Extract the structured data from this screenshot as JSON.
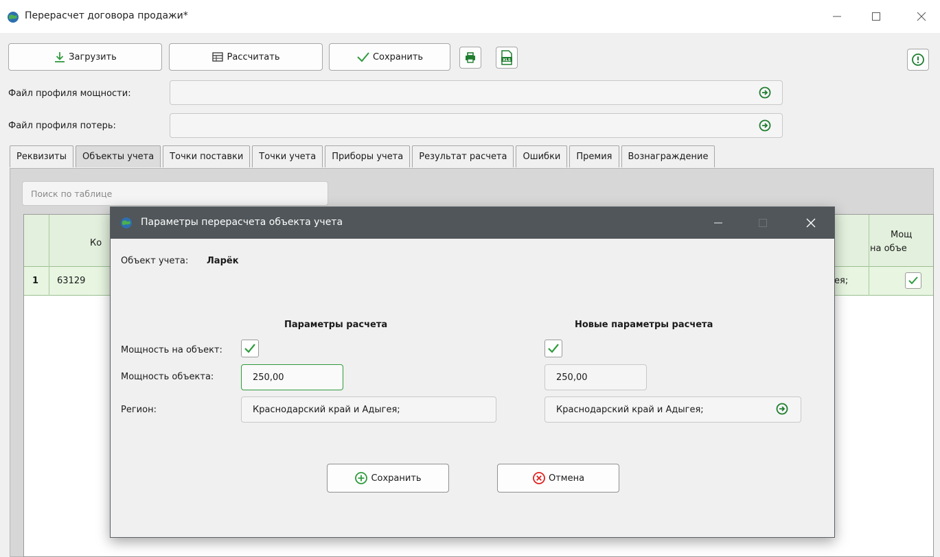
{
  "window": {
    "title": "Перерасчет договора продажи*"
  },
  "toolbar": {
    "load_label": "Загрузить",
    "calc_label": "Рассчитать",
    "save_label": "Сохранить"
  },
  "files": {
    "power_profile_label": "Файл профиля мощности:",
    "power_profile_value": "",
    "loss_profile_label": "Файл профиля потерь:",
    "loss_profile_value": ""
  },
  "tabs": [
    "Реквизиты",
    "Объекты учета",
    "Точки поставки",
    "Точки учета",
    "Приборы учета",
    "Результат расчета",
    "Ошибки",
    "Премия",
    "Вознаграждение"
  ],
  "active_tab": "Объекты учета",
  "search": {
    "placeholder": "Поиск по таблице"
  },
  "grid": {
    "header_code_partial": "Ко",
    "header_right_line1": "Мощ",
    "header_right_line2": "на объе",
    "row": {
      "number": "1",
      "code": "63129",
      "region_partial": "ея;"
    }
  },
  "dialog": {
    "title": "Параметры перерасчета объекта учета",
    "object_label": "Объект учета:",
    "object_value": "Ларёк",
    "col_current": "Параметры расчета",
    "col_new": "Новые параметры расчета",
    "power_on_label": "Мощность на объект:",
    "power_label": "Мощность объекта:",
    "region_label": "Регион:",
    "power_current": "250,00",
    "power_new": "250,00",
    "region_current": "Краснодарский край и Адыгея;",
    "region_new": "Краснодарский край и Адыгея;",
    "power_on_current": true,
    "power_on_new": true,
    "save_label": "Сохранить",
    "cancel_label": "Отмена"
  },
  "colors": {
    "accent_green": "#2e9a3c",
    "cancel_red": "#e02020",
    "dialog_titlebar": "#505659",
    "grid_header": "#e3f0dd"
  }
}
